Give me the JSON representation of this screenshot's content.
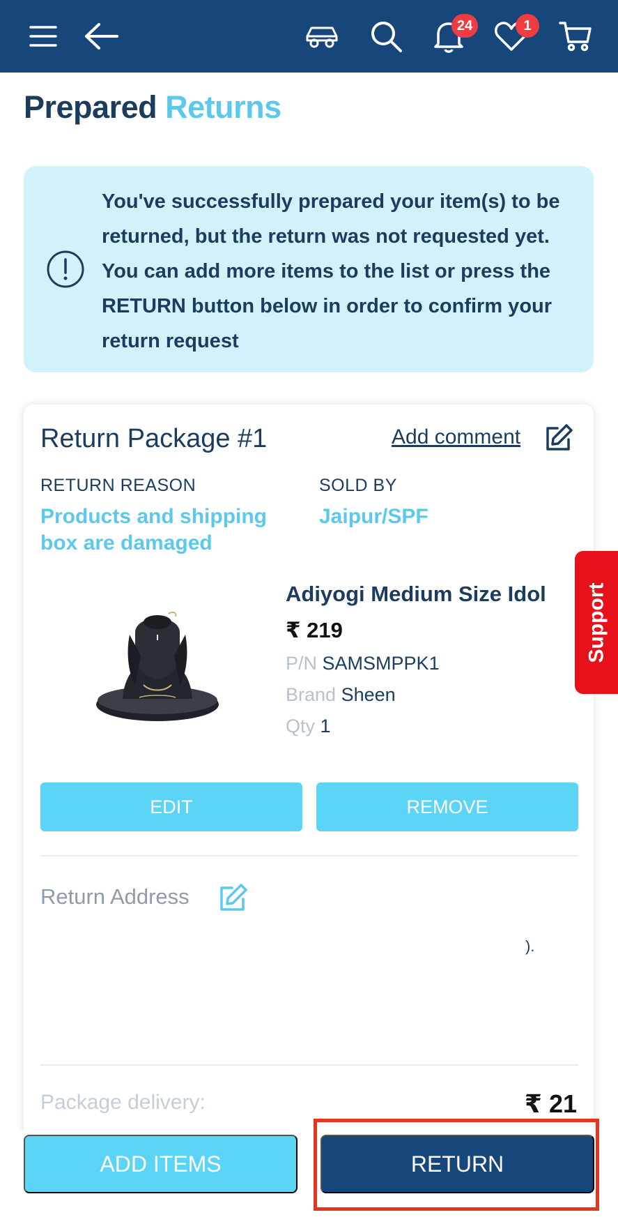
{
  "header": {
    "notification_count": "24",
    "wishlist_count": "1",
    "icons": [
      "menu-icon",
      "back-arrow-icon",
      "car-icon",
      "search-icon",
      "bell-icon",
      "heart-icon",
      "cart-icon"
    ]
  },
  "page": {
    "title_part1": "Prepared",
    "title_part2": "Returns"
  },
  "info_banner": {
    "message": "You've successfully prepared your item(s) to be returned, but the return was not requested yet. You can add more items to the list or press the RETURN button below in order to confirm your return request"
  },
  "package": {
    "title": "Return Package #1",
    "add_comment": "Add comment",
    "reason_label": "RETURN REASON",
    "reason_value": "Products and shipping box are damaged",
    "sold_by_label": "SOLD BY",
    "sold_by_value": "Jaipur/SPF",
    "product": {
      "name": "Adiyogi Medium Size Idol",
      "price": "₹ 219",
      "pn_label": "P/N",
      "pn_value": "SAMSMPPK1",
      "brand_label": "Brand",
      "brand_value": "Sheen",
      "qty_label": "Qty",
      "qty_value": "1"
    },
    "edit_label": "EDIT",
    "remove_label": "REMOVE",
    "return_address_label": "Return Address",
    "address_fragment": ").",
    "delivery_label": "Package delivery:",
    "delivery_value": "₹ 21"
  },
  "support_label": "Support",
  "footer": {
    "add_items_label": "ADD ITEMS",
    "return_label": "RETURN"
  },
  "colors": {
    "header_bg": "#17467a",
    "accent_light": "#5cd4f5",
    "accent_text": "#5cc9ec",
    "banner_bg": "#d1f1fb",
    "badge": "#ef3b42",
    "support": "#e6111b",
    "highlight": "#e4351f"
  }
}
